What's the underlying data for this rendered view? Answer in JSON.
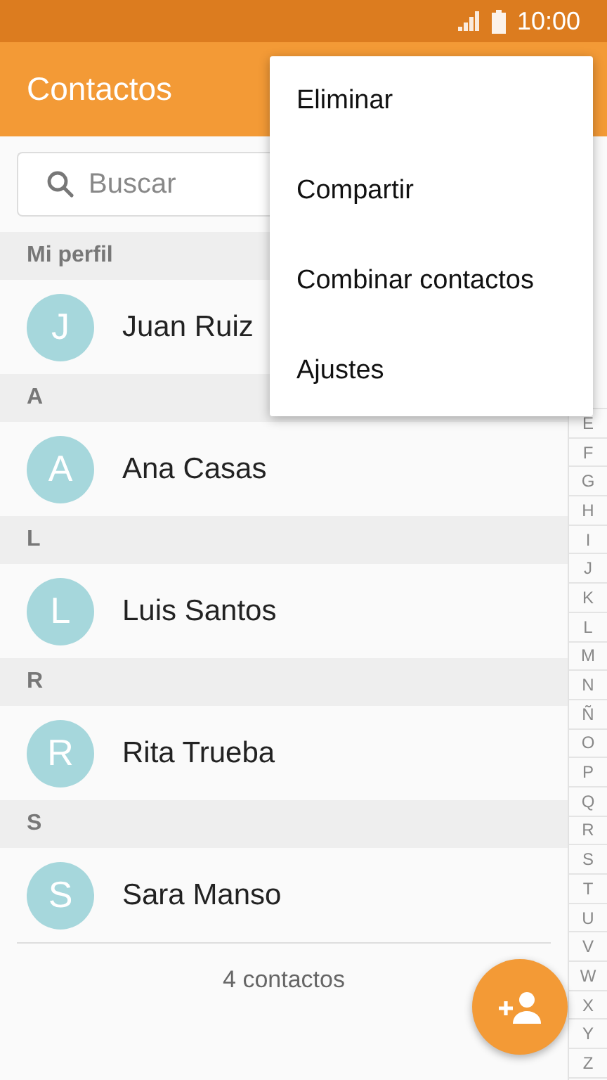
{
  "status_bar": {
    "time": "10:00"
  },
  "app_bar": {
    "title": "Contactos"
  },
  "search": {
    "placeholder": "Buscar"
  },
  "sections": [
    {
      "header": "Mi perfil",
      "contacts": [
        {
          "initial": "J",
          "name": "Juan Ruiz"
        }
      ]
    },
    {
      "header": "A",
      "contacts": [
        {
          "initial": "A",
          "name": "Ana Casas"
        }
      ]
    },
    {
      "header": "L",
      "contacts": [
        {
          "initial": "L",
          "name": "Luis Santos"
        }
      ]
    },
    {
      "header": "R",
      "contacts": [
        {
          "initial": "R",
          "name": "Rita Trueba"
        }
      ]
    },
    {
      "header": "S",
      "contacts": [
        {
          "initial": "S",
          "name": "Sara Manso"
        }
      ]
    }
  ],
  "contact_count": "4 contactos",
  "index": [
    "E",
    "F",
    "G",
    "H",
    "I",
    "J",
    "K",
    "L",
    "M",
    "N",
    "Ñ",
    "O",
    "P",
    "Q",
    "R",
    "S",
    "T",
    "U",
    "V",
    "W",
    "X",
    "Y",
    "Z"
  ],
  "menu": {
    "items": [
      "Eliminar",
      "Compartir",
      "Combinar contactos",
      "Ajustes"
    ]
  }
}
